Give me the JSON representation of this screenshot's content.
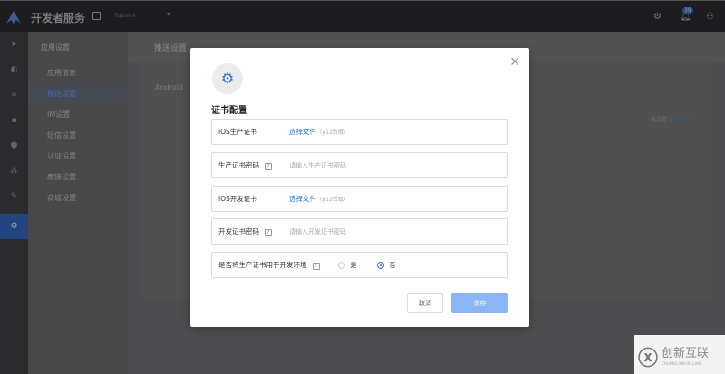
{
  "topbar": {
    "brand": "开发者服务",
    "app_name": "flutter-x",
    "notification_count": "39",
    "icons": [
      "logo-icon",
      "app-icon",
      "chevron-down-icon",
      "settings-icon",
      "bell-icon",
      "user-icon"
    ]
  },
  "rail": {
    "icons": [
      "send-icon",
      "compass-icon",
      "link-icon",
      "message-icon",
      "shield-icon",
      "cluster-icon",
      "edit-icon",
      "gear-icon"
    ]
  },
  "sidebar": {
    "heading": "应用设置",
    "items": [
      {
        "label": "应用信息"
      },
      {
        "label": "推送设置",
        "active": true
      },
      {
        "label": "IM设置"
      },
      {
        "label": "短信设置"
      },
      {
        "label": "认证设置"
      },
      {
        "label": "魔链设置"
      },
      {
        "label": "商城设置"
      }
    ]
  },
  "main": {
    "title": "推送设置",
    "platform": "Android",
    "status": "未设置",
    "doc_link": "集成文档"
  },
  "modal": {
    "title": "证书配置",
    "rows": [
      {
        "label": "iOS生产证书",
        "file_button": "选择文件",
        "hint": "(p12后缀)"
      },
      {
        "label": "生产证书密码",
        "help": "?",
        "placeholder": "请输入生产证书密码"
      },
      {
        "label": "iOS开发证书",
        "file_button": "选择文件",
        "hint": "(p12后缀)"
      },
      {
        "label": "开发证书密码",
        "help": "?",
        "placeholder": "请输入开发证书密码"
      },
      {
        "label": "是否将生产证书用于开发环境",
        "help": "?",
        "options": [
          "是",
          "否"
        ],
        "selected": "否"
      }
    ],
    "cancel": "取消",
    "save": "保存"
  },
  "watermark": {
    "name": "创新互联",
    "sub": "CHUANG XIN HU LIAN"
  },
  "colors": {
    "accent": "#2b6fe6",
    "save_disabled": "#8ab6f5"
  }
}
